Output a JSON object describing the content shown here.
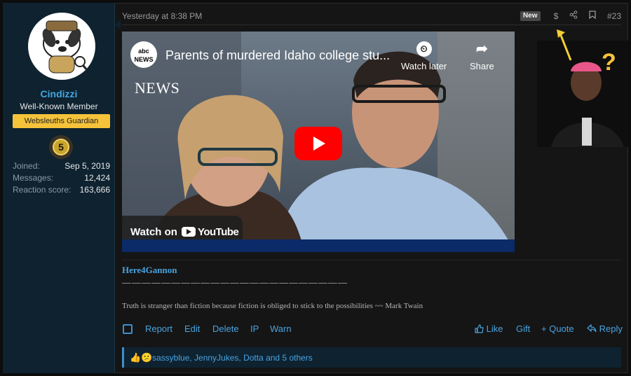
{
  "user": {
    "name": "Cindizzi",
    "title": "Well-Known Member",
    "banner": "Websleuths Guardian",
    "trophy_level": "5",
    "stats": [
      {
        "label": "Joined:",
        "value": "Sep 5, 2019"
      },
      {
        "label": "Messages:",
        "value": "12,424"
      },
      {
        "label": "Reaction score:",
        "value": "163,666"
      }
    ]
  },
  "post": {
    "date": "Yesterday at 8:38 PM",
    "new_badge": "New",
    "number": "#23",
    "header_icons": [
      "dollar-icon",
      "share-icon",
      "bookmark-icon"
    ]
  },
  "video": {
    "channel_badge": "abc NEWS",
    "news_mark": "NEWS",
    "title": "Parents of murdered Idaho college stu...",
    "watch_later": "Watch later",
    "share": "Share",
    "watch_on": "Watch on",
    "youtube": "YouTube"
  },
  "signature": {
    "name": "Here4Gannon",
    "dashes": "———————————————————————",
    "quote": "Truth is stranger than fiction because fiction is obliged to stick to the possibilities ~~ Mark Twain"
  },
  "actions": {
    "left": [
      "Report",
      "Edit",
      "Delete",
      "IP",
      "Warn"
    ],
    "like": "Like",
    "gift": "Gift",
    "quote": "+ Quote",
    "reply": "Reply"
  },
  "reactions": {
    "icons": "👍😕",
    "text": "sassyblue, JennyJukes, Dotta and 5 others"
  },
  "colors": {
    "accent": "#4aa3df",
    "banner": "#f5c33a",
    "sidebar": "#0e2230",
    "youtube_red": "#ff0000"
  }
}
